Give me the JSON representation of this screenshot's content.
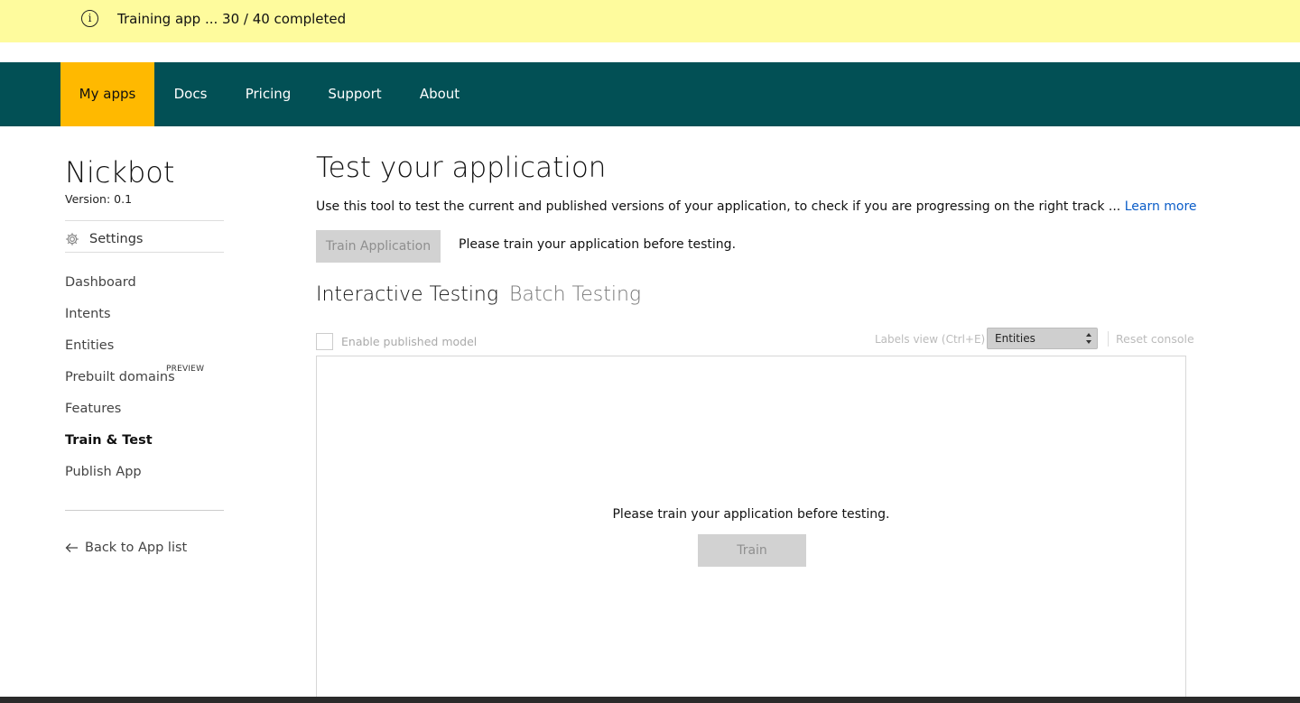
{
  "banner": {
    "text": "Training app ... 30 / 40 completed",
    "icon": "info-icon"
  },
  "nav": {
    "items": [
      {
        "label": "My apps",
        "active": true
      },
      {
        "label": "Docs"
      },
      {
        "label": "Pricing"
      },
      {
        "label": "Support"
      },
      {
        "label": "About"
      }
    ]
  },
  "sidebar": {
    "app_name": "Nickbot",
    "version": "Version:  0.1",
    "settings_label": "Settings",
    "items": [
      {
        "label": "Dashboard"
      },
      {
        "label": "Intents"
      },
      {
        "label": "Entities"
      },
      {
        "label": "Prebuilt domains",
        "badge": "PREVIEW"
      },
      {
        "label": "Features"
      },
      {
        "label": "Train & Test",
        "active": true
      },
      {
        "label": "Publish App"
      }
    ],
    "back_label": "Back to App list"
  },
  "main": {
    "title": "Test your application",
    "description": "Use this tool to test the current and published versions of your application, to check if you are progressing on the right track ...",
    "learn_more": "Learn more",
    "train_button": "Train Application",
    "train_hint": "Please train your application before testing.",
    "tabs": [
      {
        "label": "Interactive Testing",
        "active": true
      },
      {
        "label": "Batch Testing"
      }
    ],
    "toolbar": {
      "enable_published_label": "Enable published model",
      "labels_view": "Labels view (Ctrl+E)",
      "labels_select_value": "Entities",
      "reset_console": "Reset console"
    },
    "console": {
      "hint": "Please train your application before testing.",
      "train_button": "Train"
    }
  },
  "colors": {
    "banner_bg": "#fefb9d",
    "nav_bg": "#025055",
    "nav_active_bg": "#ffb900",
    "link": "#0a5cc8"
  }
}
